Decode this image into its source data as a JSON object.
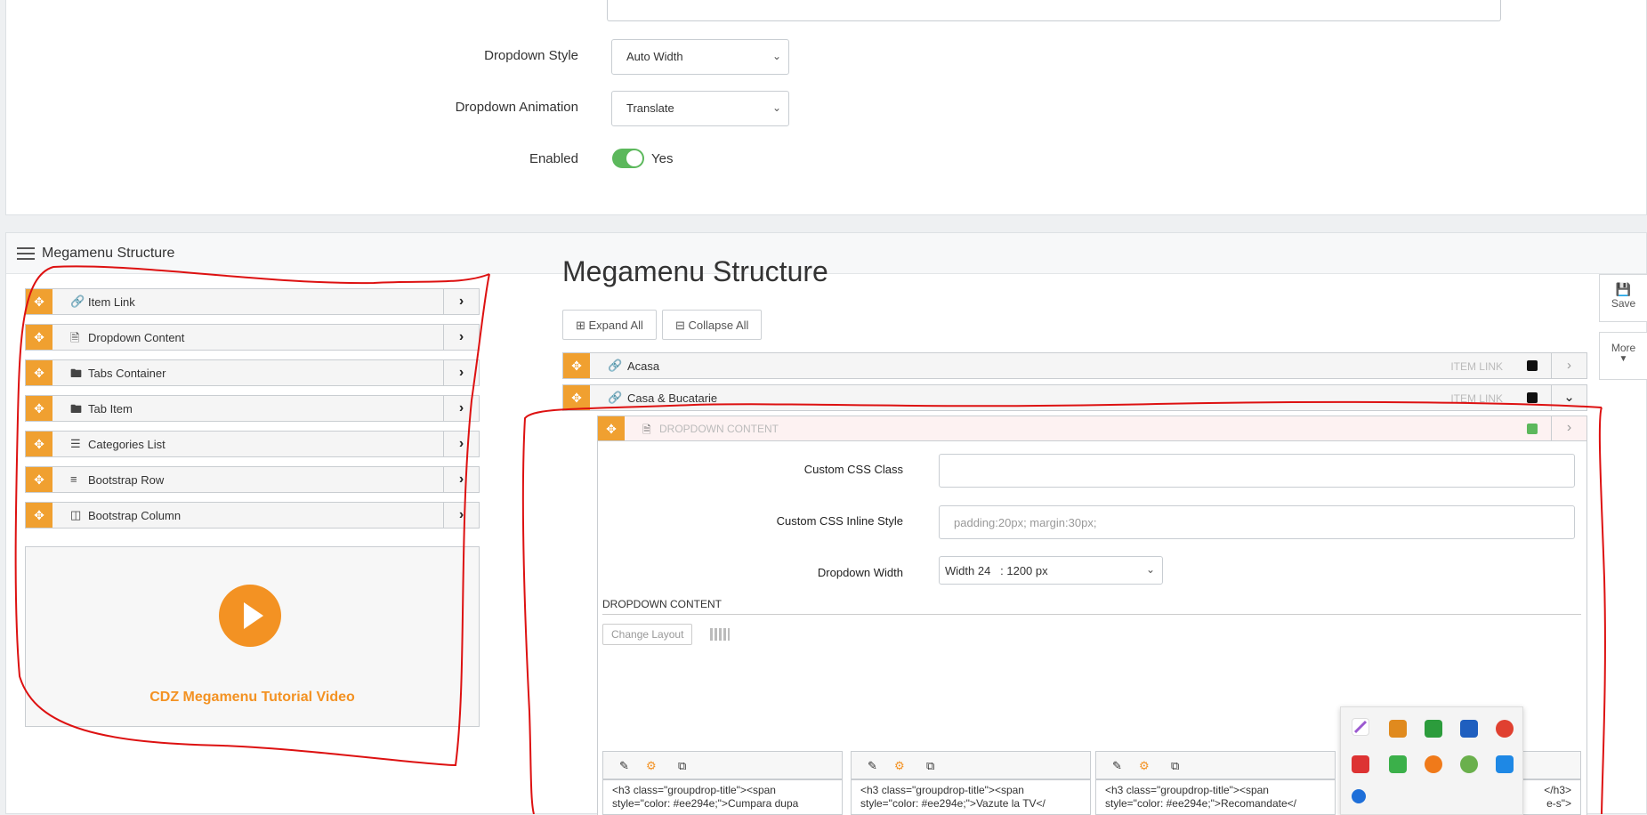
{
  "settings": {
    "dropdown_style": {
      "label": "Dropdown Style",
      "value": "Auto Width"
    },
    "dropdown_animation": {
      "label": "Dropdown Animation",
      "value": "Translate"
    },
    "enabled": {
      "label": "Enabled",
      "value": "Yes",
      "on": true
    }
  },
  "structure_panel": {
    "header_title": "Megamenu Structure",
    "elements": [
      {
        "label": "Item Link",
        "icon": "link-icon"
      },
      {
        "label": "Dropdown Content",
        "icon": "file-icon"
      },
      {
        "label": "Tabs Container",
        "icon": "folder-icon"
      },
      {
        "label": "Tab Item",
        "icon": "folder-icon"
      },
      {
        "label": "Categories List",
        "icon": "list-icon"
      },
      {
        "label": "Bootstrap Row",
        "icon": "bars-icon"
      },
      {
        "label": "Bootstrap Column",
        "icon": "columns-icon"
      }
    ],
    "video_title": "CDZ Megamenu Tutorial Video"
  },
  "tree": {
    "title": "Megamenu Structure",
    "expand_all": "Expand All",
    "collapse_all": "Collapse All",
    "items": [
      {
        "label": "Acasa",
        "type": "ITEM LINK"
      },
      {
        "label": "Casa & Bucatarie",
        "type": "ITEM LINK"
      }
    ],
    "dropdown": {
      "label": "DROPDOWN CONTENT",
      "custom_css_class": {
        "label": "Custom CSS Class",
        "value": ""
      },
      "custom_css_inline": {
        "label": "Custom CSS Inline Style",
        "placeholder": "padding:20px; margin:30px;"
      },
      "dropdown_width": {
        "label": "Dropdown Width",
        "value": "Width 24   : 1200 px"
      },
      "section_title": "DROPDOWN CONTENT",
      "change_layout": "Change Layout",
      "columns": [
        {
          "line1": "<h3 class=\"groupdrop-title\"><span",
          "line2": "style=\"color: #ee294e;\">Cumpara dupa"
        },
        {
          "line1": "<h3 class=\"groupdrop-title\"><span",
          "line2": "style=\"color: #ee294e;\">Vazute la TV</"
        },
        {
          "line1": "<h3 class=\"groupdrop-title\"><span",
          "line2": "style=\"color: #ee294e;\">Recomandate</"
        },
        {
          "line1": "</h3>",
          "line2": "e-s\">"
        }
      ]
    }
  },
  "side_actions": {
    "save": "Save",
    "more": "More"
  },
  "colors": {
    "accent": "#f39223",
    "toggle_on": "#5cb85c",
    "annotation": "#d11"
  }
}
